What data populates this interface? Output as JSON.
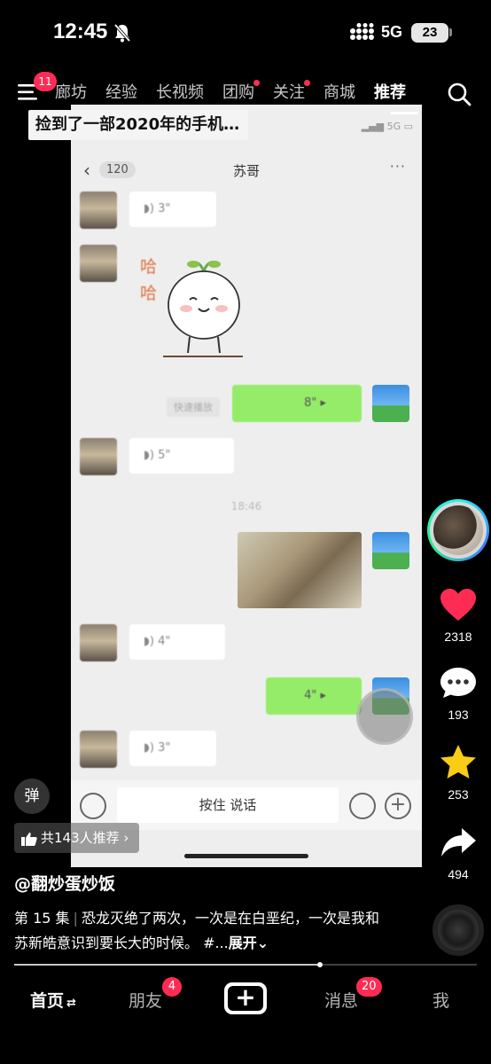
{
  "status_bar": {
    "time": "12:45",
    "network": "5G",
    "battery": "23"
  },
  "top_nav": {
    "menu_badge": "11",
    "tabs": [
      {
        "label": "廊坊",
        "dot": false
      },
      {
        "label": "经验",
        "dot": false
      },
      {
        "label": "长视频",
        "dot": false
      },
      {
        "label": "团购",
        "dot": true
      },
      {
        "label": "关注",
        "dot": true
      },
      {
        "label": "商城",
        "dot": false
      },
      {
        "label": "推荐",
        "dot": false,
        "active": true
      }
    ]
  },
  "video": {
    "title": "捡到了一部2020年的手机…",
    "inner_status": "5G",
    "chat": {
      "unread": "120",
      "name": "苏哥",
      "more": "···",
      "messages": [
        {
          "type": "voice_in",
          "duration": "3\""
        },
        {
          "type": "sticker",
          "text": [
            "哈",
            "哈"
          ]
        },
        {
          "type": "voice_out",
          "duration": "8\"",
          "convert_label": "快速播放"
        },
        {
          "type": "voice_in",
          "duration": "5\""
        },
        {
          "type": "timestamp",
          "text": "18:46"
        },
        {
          "type": "image_out"
        },
        {
          "type": "voice_in",
          "duration": "4\""
        },
        {
          "type": "voice_out",
          "duration": "4\""
        },
        {
          "type": "voice_in",
          "duration": "3\""
        }
      ],
      "input_bar": {
        "talk_label": "按住 说话",
        "plus": "+"
      }
    }
  },
  "actions": {
    "like_count": "2318",
    "comment_count": "193",
    "favorite_count": "253",
    "share_count": "494",
    "like_color": "#fe2c55",
    "favorite_color": "#facc15"
  },
  "danmu_label": "弹",
  "recommend_label": "共143人推荐",
  "author": "@翻炒蛋炒饭",
  "description": {
    "episode": "第 15 集",
    "text": "恐龙灭绝了两次，一次是在白垩纪，一次是我和苏新皓意识到要长大的时候。 #...",
    "expand": "展开"
  },
  "progress": 0.66,
  "bottom_nav": {
    "home": "首页",
    "friends": "朋友",
    "friends_badge": "4",
    "create": "+",
    "messages": "消息",
    "messages_badge": "20",
    "me": "我"
  }
}
